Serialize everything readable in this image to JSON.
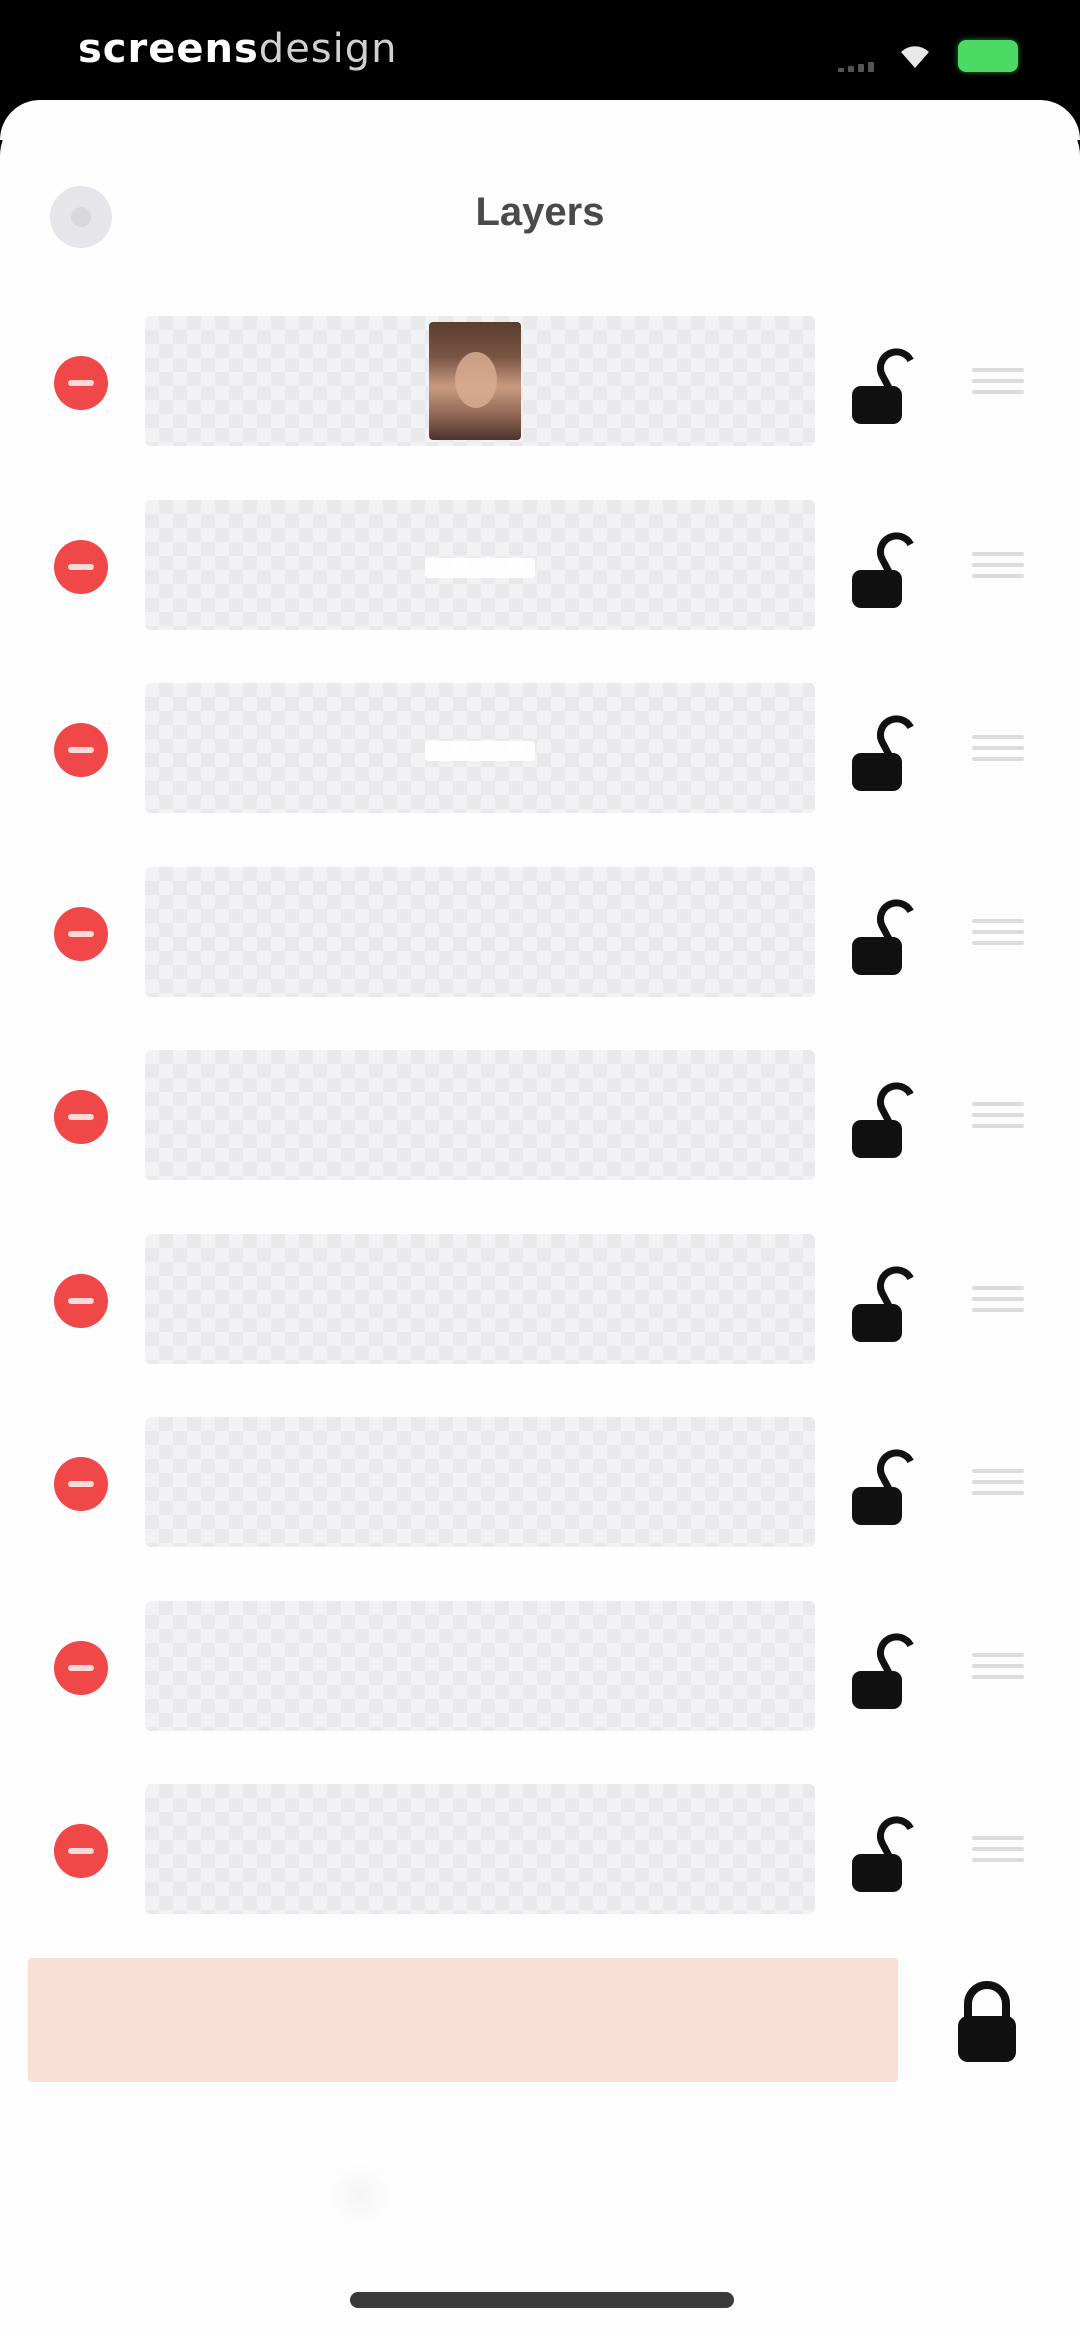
{
  "status_bar": {
    "title_bold": "screens",
    "title_light": "design"
  },
  "header": {
    "title": "Layers"
  },
  "colors": {
    "delete": "#f04848",
    "background_layer": "#f9e0d6",
    "battery": "#4cd964"
  },
  "layers": [
    {
      "thumb": "photo",
      "locked": false
    },
    {
      "thumb": "white-bar",
      "locked": false
    },
    {
      "thumb": "white-bar",
      "locked": false
    },
    {
      "thumb": "transparent",
      "locked": false
    },
    {
      "thumb": "transparent",
      "locked": false
    },
    {
      "thumb": "transparent",
      "locked": false
    },
    {
      "thumb": "transparent",
      "locked": false
    },
    {
      "thumb": "transparent",
      "locked": false
    },
    {
      "thumb": "transparent",
      "locked": false
    }
  ],
  "background_layer": {
    "locked": true
  }
}
